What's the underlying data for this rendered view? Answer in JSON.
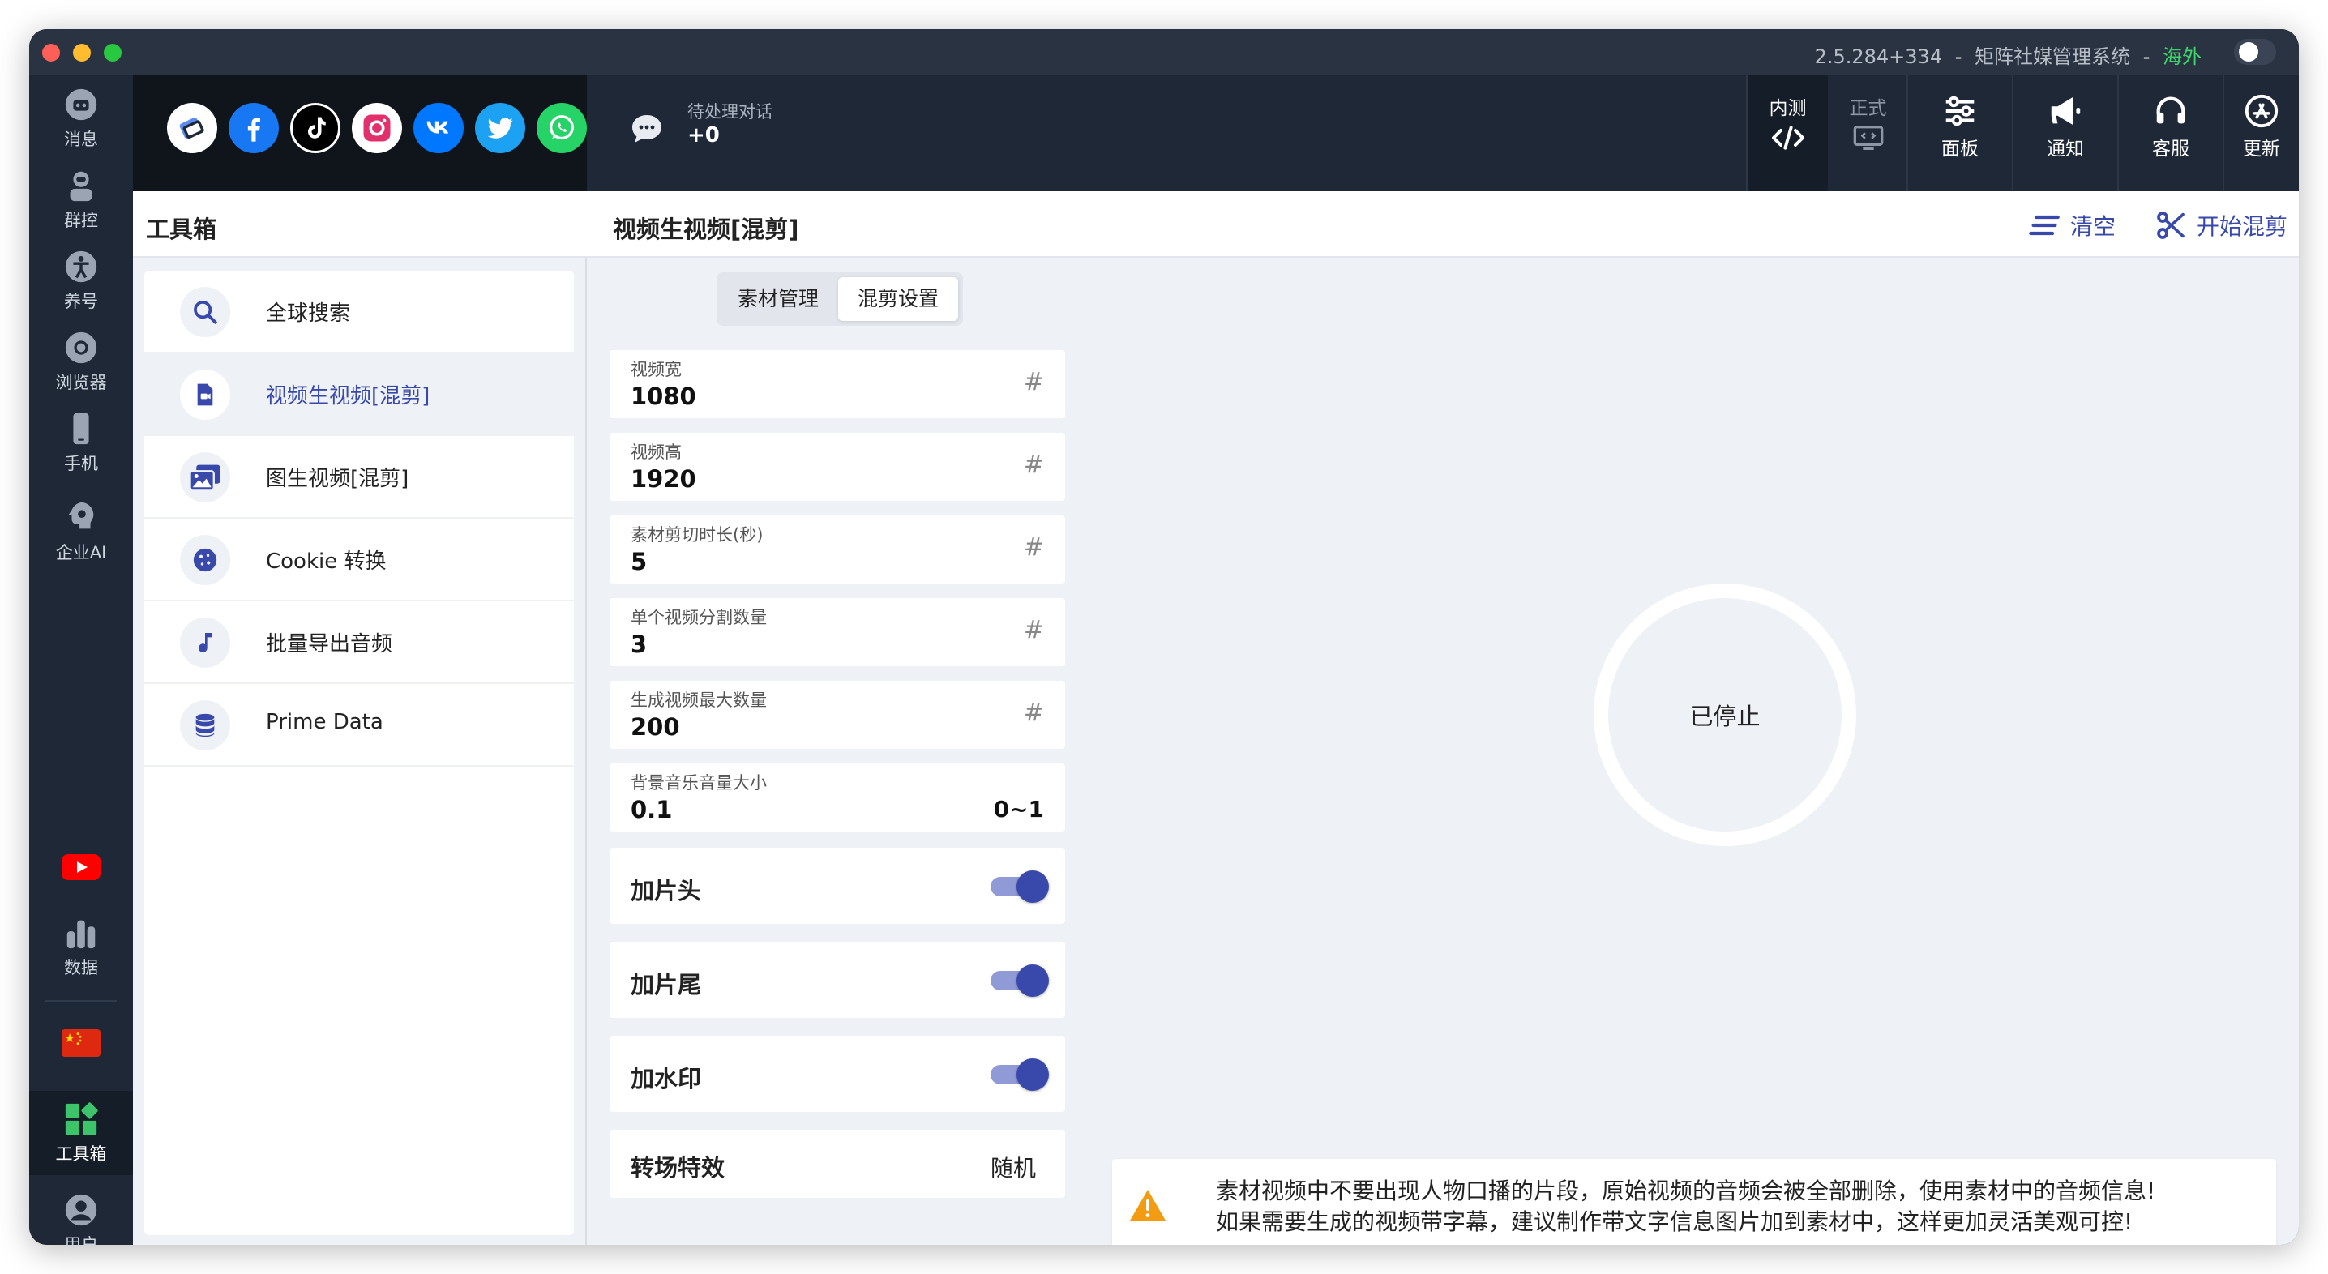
{
  "window": {
    "version": "2.5.284+334",
    "separator": "-",
    "app_name": "矩阵社媒管理系统",
    "region_separator": "-",
    "region": "海外"
  },
  "rail": {
    "items": [
      {
        "label": "消息"
      },
      {
        "label": "群控"
      },
      {
        "label": "养号"
      },
      {
        "label": "浏览器"
      },
      {
        "label": "手机"
      },
      {
        "label": "企业AI"
      },
      {
        "label": "数据"
      },
      {
        "label": "工具箱"
      },
      {
        "label": "用户"
      }
    ]
  },
  "topbar": {
    "pending_label": "待处理对话",
    "pending_count": "+0",
    "env_beta": "内测",
    "env_prod": "正式",
    "buttons": [
      {
        "label": "面板"
      },
      {
        "label": "通知"
      },
      {
        "label": "客服"
      },
      {
        "label": "更新"
      }
    ]
  },
  "toolbox": {
    "title": "工具箱",
    "items": [
      {
        "label": "全球搜索"
      },
      {
        "label": "视频生视频[混剪]"
      },
      {
        "label": "图生视频[混剪]"
      },
      {
        "label": "Cookie 转换"
      },
      {
        "label": "批量导出音频"
      },
      {
        "label": "Prime Data"
      }
    ]
  },
  "main": {
    "title": "视频生视频[混剪]",
    "clear_label": "清空",
    "start_label": "开始混剪",
    "tabs": [
      {
        "label": "素材管理"
      },
      {
        "label": "混剪设置"
      }
    ],
    "fields": [
      {
        "label": "视频宽",
        "value": "1080",
        "suffix": "#"
      },
      {
        "label": "视频高",
        "value": "1920",
        "suffix": "#"
      },
      {
        "label": "素材剪切时长(秒)",
        "value": "5",
        "suffix": "#"
      },
      {
        "label": "单个视频分割数量",
        "value": "3",
        "suffix": "#"
      },
      {
        "label": "生成视频最大数量",
        "value": "200",
        "suffix": "#"
      },
      {
        "label": "背景音乐音量大小",
        "value": "0.1",
        "suffix": "0~1"
      }
    ],
    "toggles": [
      {
        "label": "加片头",
        "on": true
      },
      {
        "label": "加片尾",
        "on": true
      },
      {
        "label": "加水印",
        "on": true
      }
    ],
    "transition": {
      "label": "转场特效",
      "value": "随机"
    },
    "status": "已停止",
    "notice": {
      "line1": "素材视频中不要出现人物口播的片段，原始视频的音频会被全部删除，使用素材中的音频信息!",
      "line2": "如果需要生成的视频带字幕，建议制作带文字信息图片加到素材中，这样更加灵活美观可控!"
    }
  },
  "colors": {
    "accent": "#3949ab",
    "rail_bg": "#1e2836",
    "content_bg": "#eef1f5",
    "warning": "#f39c12",
    "region_green": "#3dd66b"
  }
}
